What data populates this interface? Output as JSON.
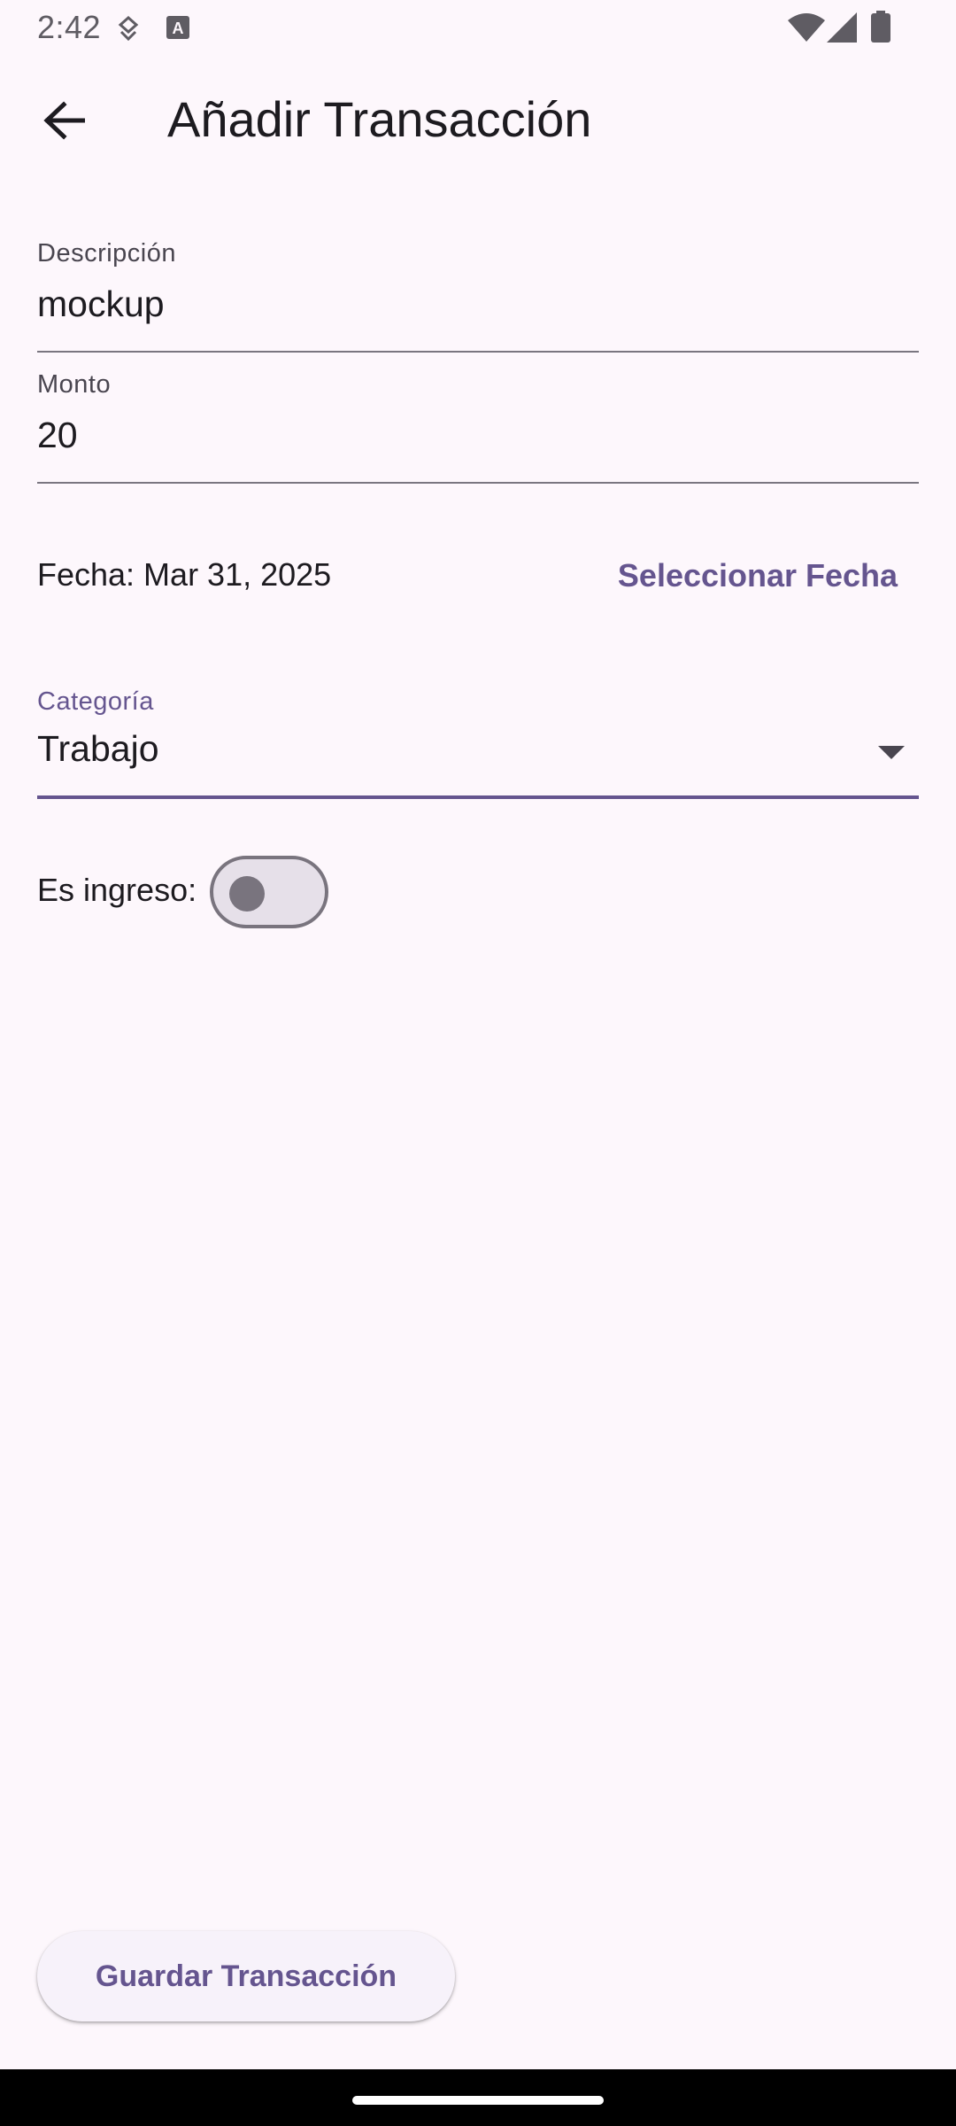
{
  "status_bar": {
    "time": "2:42",
    "icons": [
      "shield-icon",
      "keyboard-icon",
      "wifi-icon",
      "signal-icon",
      "battery-icon"
    ]
  },
  "app_bar": {
    "back_icon": "arrow-back-icon",
    "title": "Añadir Transacción"
  },
  "form": {
    "description": {
      "label": "Descripción",
      "value": "mockup"
    },
    "amount": {
      "label": "Monto",
      "value": "20"
    },
    "date": {
      "text": "Fecha: Mar 31, 2025",
      "select_label": "Seleccionar Fecha"
    },
    "category": {
      "label": "Categoría",
      "value": "Trabajo",
      "icon": "dropdown-arrow-icon"
    },
    "is_income": {
      "label": "Es ingreso:",
      "checked": false
    }
  },
  "actions": {
    "save_label": "Guardar Transacción"
  },
  "colors": {
    "background": "#fdf7fc",
    "accent": "#65558f",
    "outline": "#79747e",
    "text": "#1d1b20"
  }
}
